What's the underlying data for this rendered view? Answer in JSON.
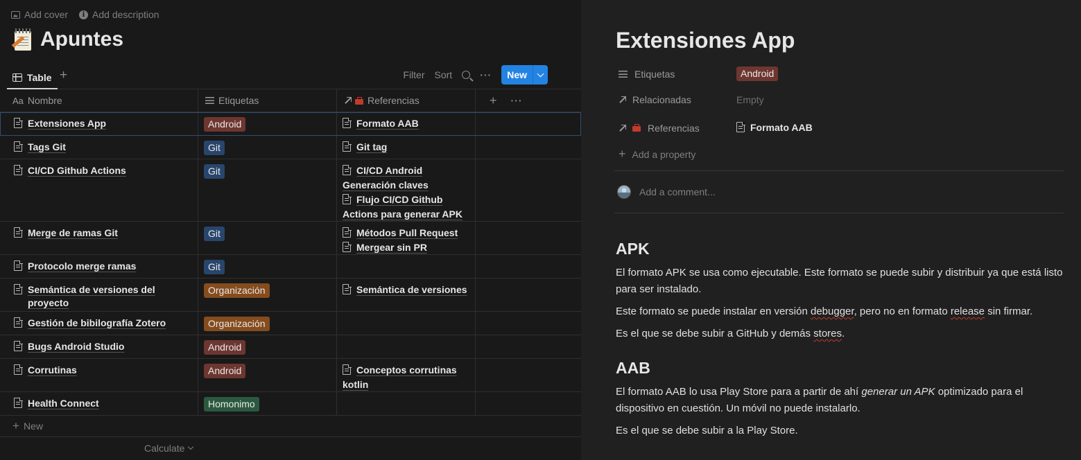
{
  "top_actions": {
    "add_cover": "Add cover",
    "add_description": "Add description"
  },
  "page": {
    "title": "Apuntes",
    "emoji": "spiral-notepad-icon"
  },
  "view": {
    "tab_label": "Table",
    "filter": "Filter",
    "sort": "Sort",
    "new_button": "New"
  },
  "columns": {
    "name_prefix": "Aa",
    "name": "Nombre",
    "tags": "Etiquetas",
    "refs": "Referencias"
  },
  "rows": [
    {
      "name": "Extensiones App",
      "tag": "Android",
      "refs": [
        "Formato AAB"
      ]
    },
    {
      "name": "Tags Git",
      "tag": "Git",
      "refs": [
        "Git tag"
      ]
    },
    {
      "name": "CI/CD Github Actions",
      "tag": "Git",
      "refs": [
        "CI/CD Android Generación claves",
        "Flujo CI/CD Github Actions para generar APK"
      ]
    },
    {
      "name": "Merge de ramas Git",
      "tag": "Git",
      "refs": [
        "Métodos Pull Request",
        "Mergear sin PR"
      ]
    },
    {
      "name": "Protocolo merge ramas",
      "tag": "Git",
      "refs": []
    },
    {
      "name": "Semántica de versiones del proyecto",
      "tag": "Organización",
      "refs": [
        "Semántica de versiones"
      ]
    },
    {
      "name": "Gestión de bibilografía Zotero",
      "tag": "Organización",
      "refs": []
    },
    {
      "name": "Bugs Android Studio",
      "tag": "Android",
      "refs": []
    },
    {
      "name": "Corrutinas",
      "tag": "Android",
      "refs": [
        "Conceptos corrutinas kotlin"
      ]
    },
    {
      "name": "Health Connect",
      "tag": "Homonimo",
      "refs": []
    }
  ],
  "table_footer": {
    "new_row": "New",
    "calculate": "Calculate"
  },
  "detail": {
    "title": "Extensiones App",
    "props": {
      "tags_label": "Etiquetas",
      "tags_value": "Android",
      "related_label": "Relacionadas",
      "related_value": "Empty",
      "refs_label": "Referencias",
      "refs_value": "Formato AAB"
    },
    "add_property": "Add a property",
    "comment_placeholder": "Add a comment...",
    "apk_heading": "APK",
    "apk_p1": "El formato APK se usa como ejecutable. Este formato se puede subir y distribuir ya que está listo para ser instalado.",
    "apk_p2_a": "Este formato se puede instalar en versión ",
    "apk_p2_b": "debugger",
    "apk_p2_c": ", pero no en formato ",
    "apk_p2_d": "release",
    "apk_p2_e": " sin firmar.",
    "apk_p3_a": "Es el que se debe subir a GitHub y demás ",
    "apk_p3_b": "stores",
    "apk_p3_c": ".",
    "aab_heading": "AAB",
    "aab_p1_a": "El formato AAB lo usa Play Store para a partir de ahí ",
    "aab_p1_b": "generar un APK",
    "aab_p1_c": " optimizado para el dispositivo en cuestión. Un móvil no puede instalarlo.",
    "aab_p2": "Es el que se debe subir a la Play Store."
  },
  "colors": {
    "accent": "#2383e2",
    "android_tag": "#6e3630",
    "git_tag": "#28456c",
    "org_tag": "#854c1d",
    "homonimo_tag": "#2b593f"
  }
}
